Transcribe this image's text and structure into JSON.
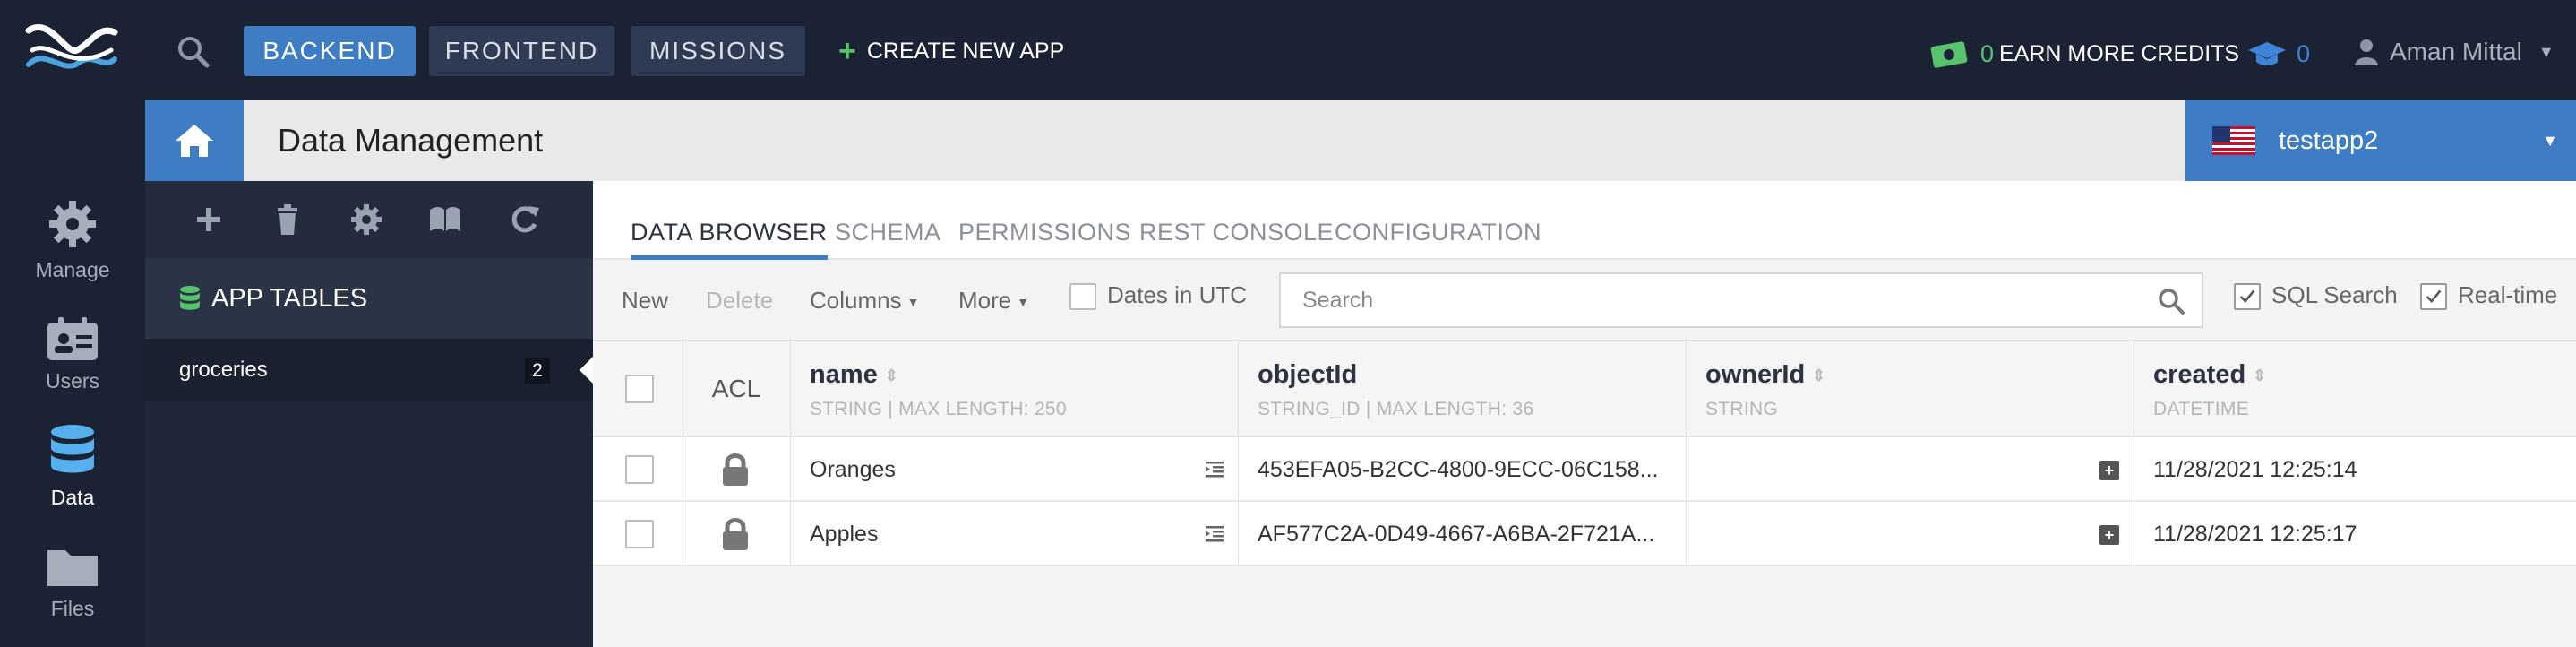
{
  "topbar": {
    "nav": [
      "BACKEND",
      "FRONTEND",
      "MISSIONS"
    ],
    "create_app": "CREATE NEW APP",
    "credits_count": "0",
    "credits_label": "EARN MORE CREDITS",
    "grad_count": "0",
    "user_name": "Aman Mittal"
  },
  "rail": {
    "items": [
      {
        "label": "Manage",
        "icon": "gear-icon"
      },
      {
        "label": "Users",
        "icon": "users-card-icon"
      },
      {
        "label": "Data",
        "icon": "database-icon"
      },
      {
        "label": "Files",
        "icon": "folder-icon"
      }
    ]
  },
  "page": {
    "title": "Data Management",
    "app_name": "testapp2"
  },
  "sidebar": {
    "section_title": "APP TABLES",
    "tables": [
      {
        "name": "groceries",
        "count": "2"
      }
    ]
  },
  "tabs": [
    "DATA BROWSER",
    "SCHEMA",
    "PERMISSIONS",
    "REST CONSOLE",
    "CONFIGURATION"
  ],
  "toolbar": {
    "new": "New",
    "delete": "Delete",
    "columns": "Columns",
    "more": "More",
    "dates_utc": "Dates in UTC",
    "search_placeholder": "Search",
    "sql_search": "SQL Search",
    "realtime": "Real-time"
  },
  "table": {
    "acl": "ACL",
    "columns": [
      {
        "name": "name",
        "type": "STRING | MAX LENGTH: 250"
      },
      {
        "name": "objectId",
        "type": "STRING_ID | MAX LENGTH: 36"
      },
      {
        "name": "ownerId",
        "type": "STRING"
      },
      {
        "name": "created",
        "type": "DATETIME"
      }
    ],
    "rows": [
      {
        "name": "Oranges",
        "objectId": "453EFA05-B2CC-4800-9ECC-06C158...",
        "ownerId": "",
        "created": "11/28/2021 12:25:14"
      },
      {
        "name": "Apples",
        "objectId": "AF577C2A-0D49-4667-A6BA-2F721A...",
        "ownerId": "",
        "created": "11/28/2021 12:25:17"
      }
    ]
  },
  "colors": {
    "nav_bg": "#1b2233",
    "accent": "#3e7dc4",
    "green": "#55c26a"
  }
}
